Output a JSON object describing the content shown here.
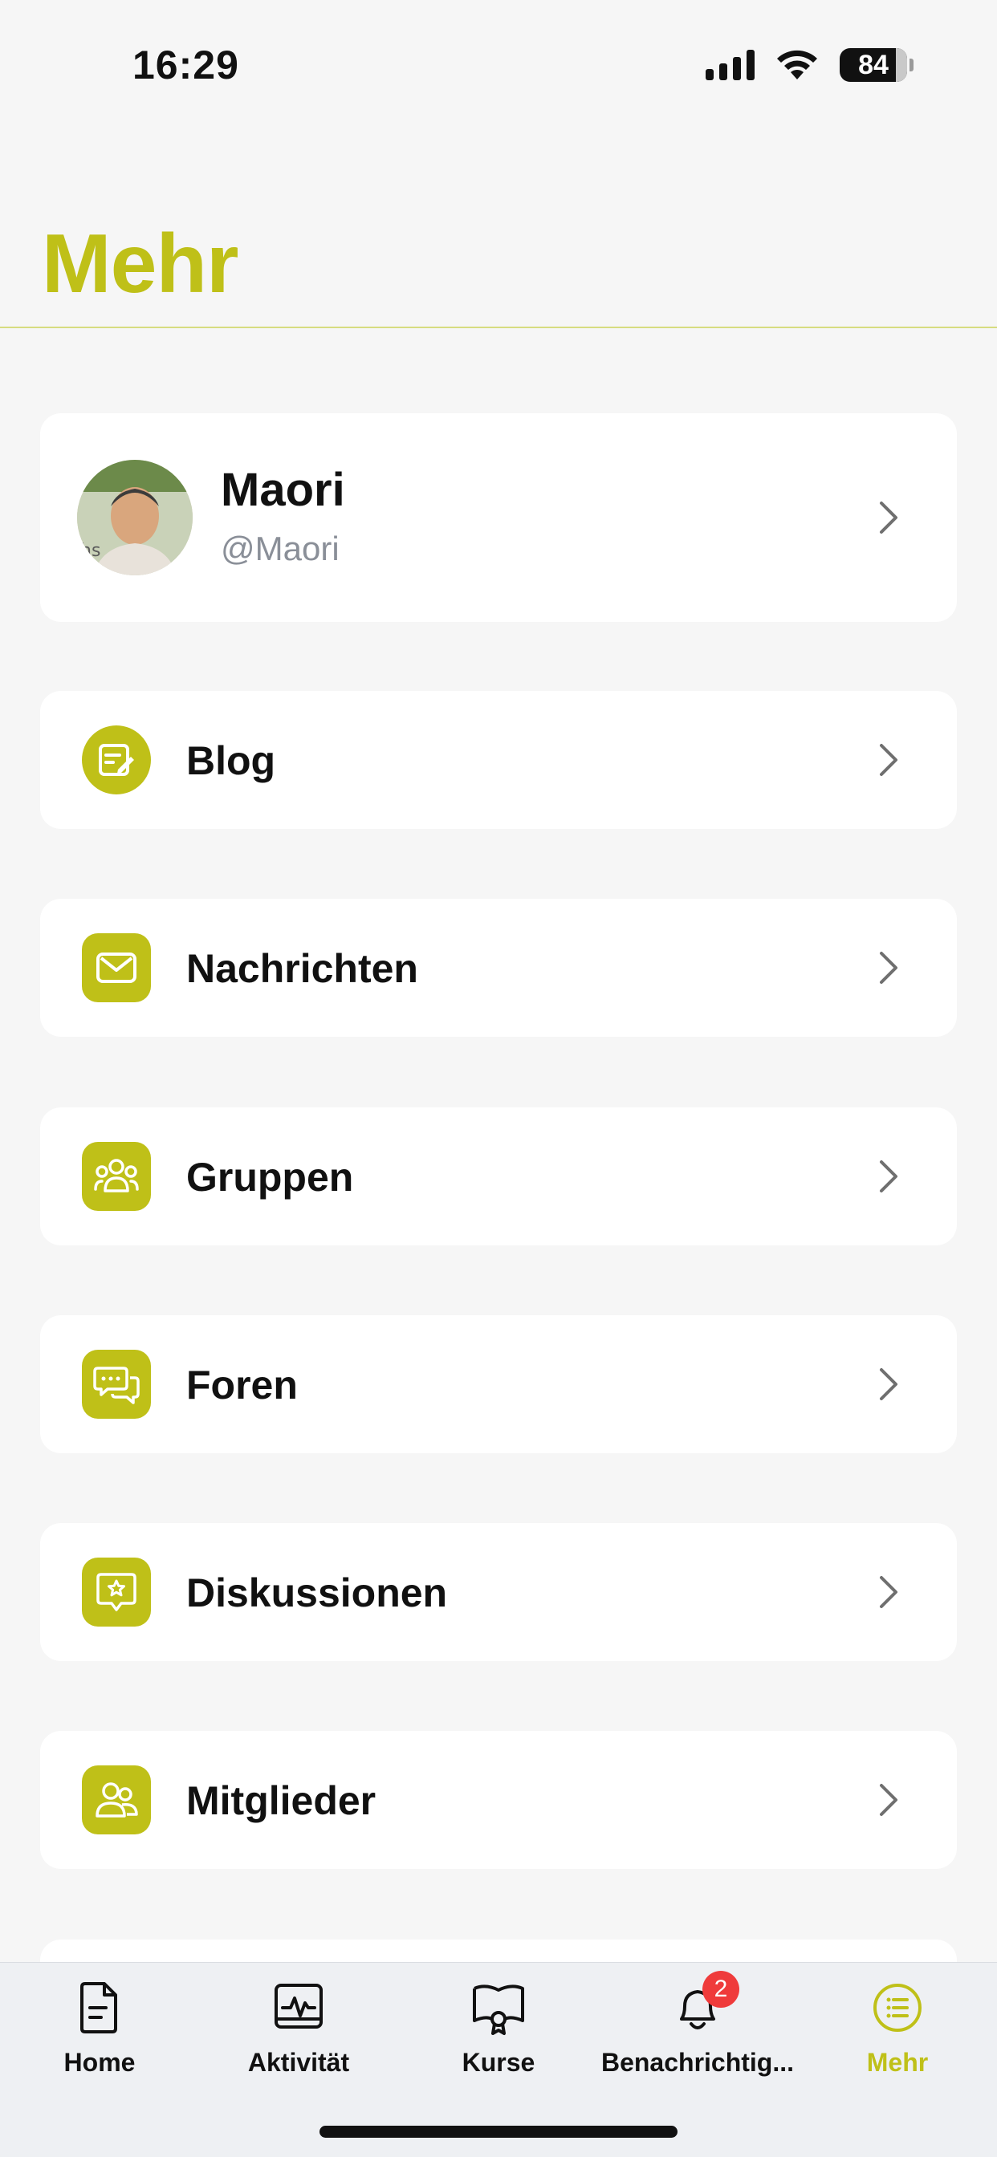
{
  "status_bar": {
    "time": "16:29",
    "battery": "84"
  },
  "header": {
    "title": "Mehr"
  },
  "profile": {
    "name": "Maori",
    "handle": "@Maori"
  },
  "menu": [
    {
      "label": "Blog",
      "icon": "blog-icon"
    },
    {
      "label": "Nachrichten",
      "icon": "mail-icon"
    },
    {
      "label": "Gruppen",
      "icon": "groups-icon"
    },
    {
      "label": "Foren",
      "icon": "forums-icon"
    },
    {
      "label": "Diskussionen",
      "icon": "discussion-icon"
    },
    {
      "label": "Mitglieder",
      "icon": "members-icon"
    }
  ],
  "tab_bar": {
    "tabs": [
      {
        "label": "Home",
        "icon": "document-icon"
      },
      {
        "label": "Aktivität",
        "icon": "activity-icon"
      },
      {
        "label": "Kurse",
        "icon": "courses-icon"
      },
      {
        "label": "Benachrichtig...",
        "icon": "bell-icon",
        "badge": "2"
      },
      {
        "label": "Mehr",
        "icon": "list-icon",
        "active": true
      }
    ]
  },
  "colors": {
    "accent": "#bfc018",
    "badge": "#ef3b3b",
    "background": "#f6f6f6"
  }
}
